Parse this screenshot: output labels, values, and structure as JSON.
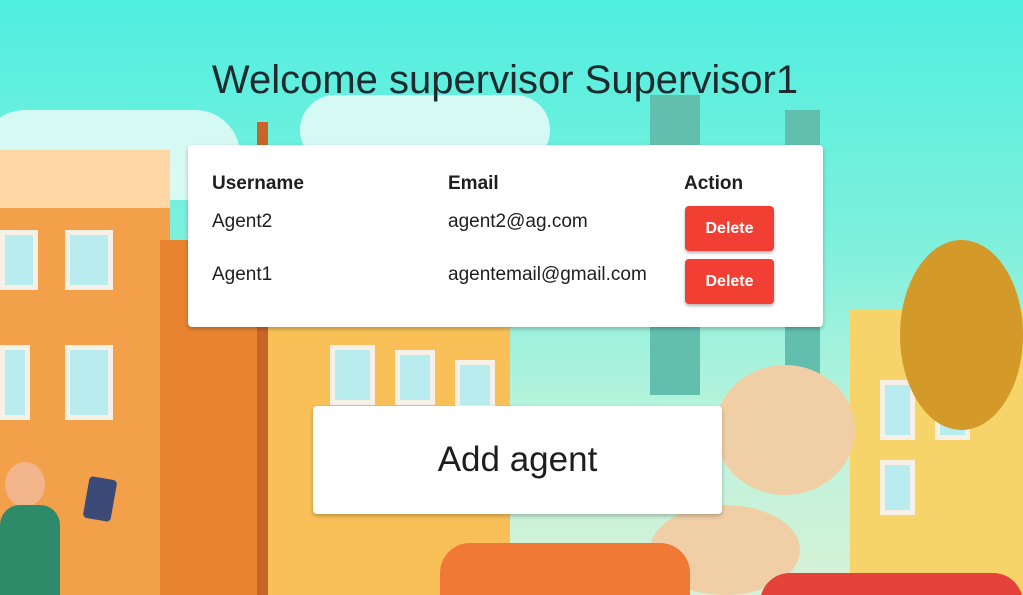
{
  "page": {
    "title": "Welcome supervisor Supervisor1"
  },
  "agents_table": {
    "headers": {
      "username": "Username",
      "email": "Email",
      "action": "Action"
    },
    "rows": [
      {
        "username": "Agent2",
        "email": "agent2@ag.com",
        "action_label": "Delete"
      },
      {
        "username": "Agent1",
        "email": "agentemail@gmail.com",
        "action_label": "Delete"
      }
    ]
  },
  "add_agent": {
    "label": "Add agent"
  },
  "colors": {
    "delete_button": "#f13f33",
    "background_top": "#4fefe0",
    "text": "#1e1e1e"
  }
}
